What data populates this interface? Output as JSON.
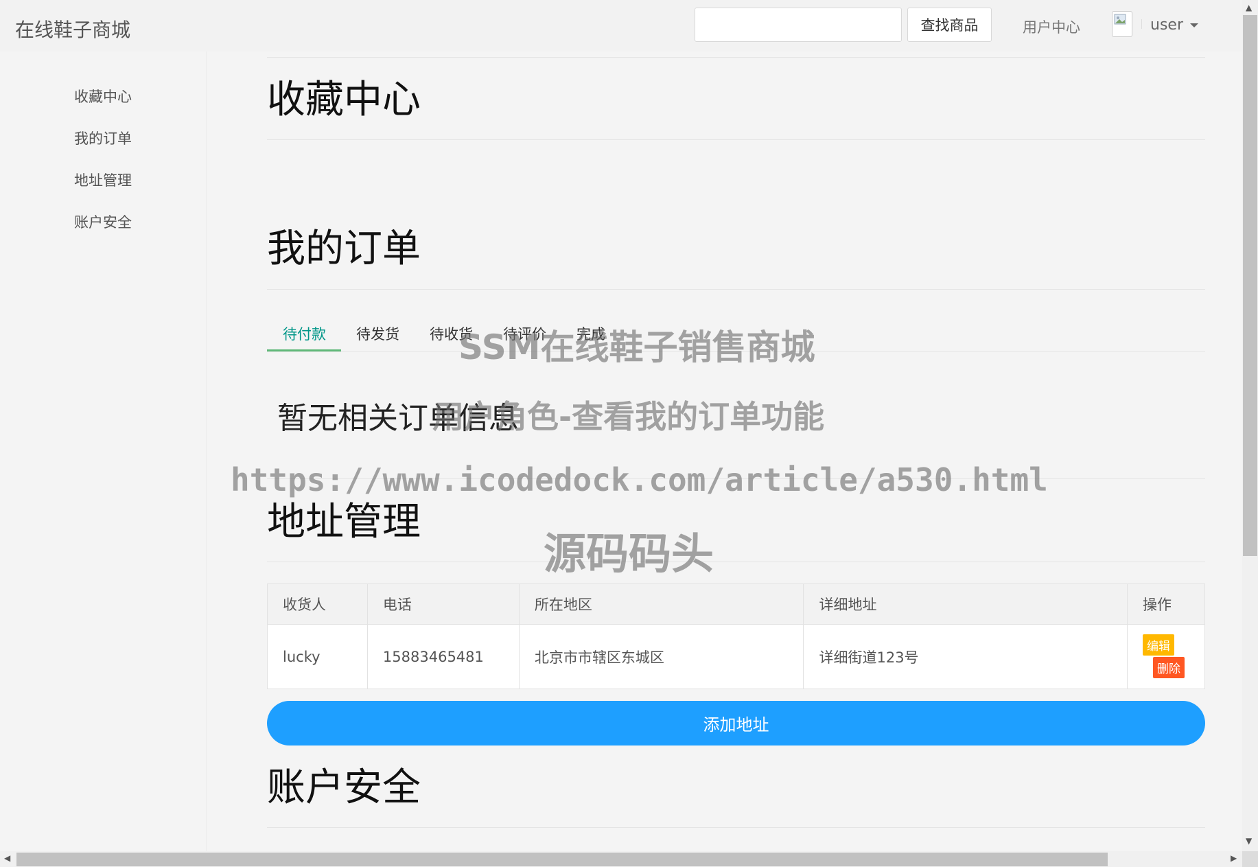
{
  "header": {
    "brand": "在线鞋子商城",
    "search_placeholder": "",
    "search_button": "查找商品",
    "user_center": "用户中心",
    "username": "user"
  },
  "sidebar": {
    "items": [
      {
        "label": "收藏中心"
      },
      {
        "label": "我的订单"
      },
      {
        "label": "地址管理"
      },
      {
        "label": "账户安全"
      }
    ]
  },
  "favorites": {
    "title": "收藏中心"
  },
  "orders": {
    "title": "我的订单",
    "tabs": [
      {
        "label": "待付款"
      },
      {
        "label": "待发货"
      },
      {
        "label": "待收货"
      },
      {
        "label": "待评价"
      },
      {
        "label": "完成"
      }
    ],
    "active_tab": "待付款",
    "empty_message": "暂无相关订单信息"
  },
  "address": {
    "title": "地址管理",
    "columns": [
      "收货人",
      "电话",
      "所在地区",
      "详细地址",
      "操作"
    ],
    "rows": [
      {
        "name": "lucky",
        "phone": "15883465481",
        "region": "北京市市辖区东城区",
        "detail": "详细街道123号"
      }
    ],
    "edit_label": "编辑",
    "delete_label": "删除",
    "add_button": "添加地址"
  },
  "security": {
    "title": "账户安全"
  },
  "watermark": {
    "line1": "SSM在线鞋子销售商城",
    "line2": "用户角色-查看我的订单功能",
    "line3": "https://www.icodedock.com/article/a530.html",
    "line4": "源码码头"
  },
  "colors": {
    "active_tab": "#009688",
    "tab_underline": "#5FB878",
    "primary_button": "#1E9FFF",
    "edit_button": "#FFB800",
    "delete_button": "#FF5722"
  }
}
